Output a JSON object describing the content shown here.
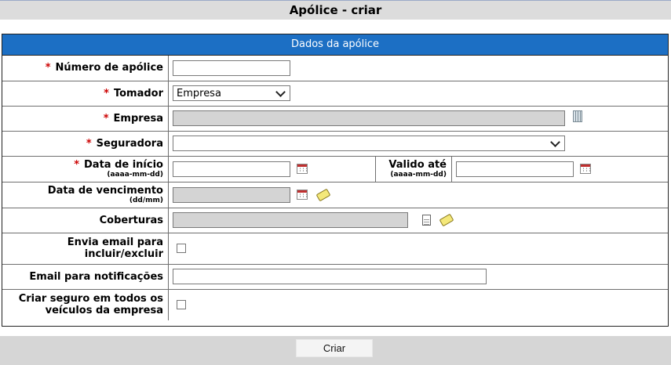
{
  "page": {
    "title": "Apólice - criar"
  },
  "section": {
    "title": "Dados da apólice"
  },
  "fields": {
    "numero_apolice": {
      "label": "Número de apólice",
      "value": ""
    },
    "tomador": {
      "label": "Tomador",
      "selected": "Empresa"
    },
    "empresa": {
      "label": "Empresa",
      "value": ""
    },
    "seguradora": {
      "label": "Seguradora",
      "selected": ""
    },
    "data_inicio": {
      "label": "Data de início",
      "format": "(aaaa-mm-dd)",
      "value": ""
    },
    "valido_ate": {
      "label": "Valido até",
      "format": "(aaaa-mm-dd)",
      "value": ""
    },
    "data_vencimento": {
      "label": "Data de vencimento",
      "format": "(dd/mm)",
      "value": ""
    },
    "coberturas": {
      "label": "Coberturas",
      "value": ""
    },
    "envia_email": {
      "label_line1": "Envia email para",
      "label_line2": "incluir/excluir",
      "checked": false
    },
    "email_notificacoes": {
      "label": "Email para notificações",
      "value": ""
    },
    "criar_seguro": {
      "label_line1": "Criar seguro em todos os",
      "label_line2": "veículos da empresa",
      "checked": false
    }
  },
  "required_marker": "*",
  "footer": {
    "submit_label": "Criar"
  },
  "colors": {
    "section_header": "#1c6fc4",
    "required": "#cc0000",
    "title_bar": "#dcdcdc",
    "footer": "#d6d6d6"
  }
}
